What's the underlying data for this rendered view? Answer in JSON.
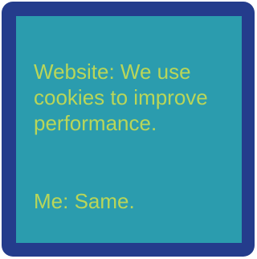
{
  "card": {
    "website_line": "Website: We use cookies to improve performance.",
    "me_line": "Me: Same."
  },
  "colors": {
    "frame": "#243c8c",
    "panel": "#2b9cae",
    "text": "#b9d659"
  }
}
